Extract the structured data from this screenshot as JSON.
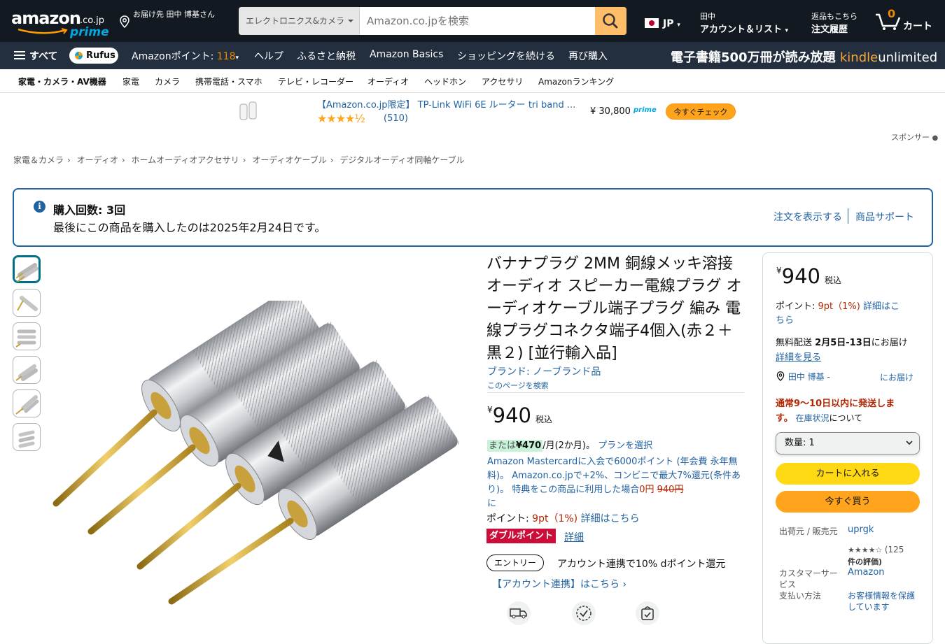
{
  "header": {
    "logo_word": "amazon",
    "logo_domain": ".co.jp",
    "logo_prime": "prime",
    "deliver_to": "お届け先 田中 博基さん",
    "search_category": "エレクトロニクス&カメラ",
    "search_placeholder": "Amazon.co.jpを検索",
    "lang": "JP",
    "account_line1": "田中",
    "account_line2": "アカウント＆リスト",
    "orders_line1": "返品もこちら",
    "orders_line2": "注文履歴",
    "cart_count": "0",
    "cart_label": "カート"
  },
  "subnav": {
    "all": "すべて",
    "rufus": "Rufus",
    "points_label": "Amazonポイント:",
    "points_value": "118",
    "items": [
      "ヘルプ",
      "ふるさと納税",
      "Amazon Basics",
      "ショッピングを続ける",
      "再び購入"
    ],
    "kindle_text": "電子書籍500万冊が読み放題",
    "kindle_brand": "kindle",
    "kindle_brand2": "unlimited"
  },
  "catbar": [
    "家電・カメラ・AV機器",
    "家電",
    "カメラ",
    "携帯電話・スマホ",
    "テレビ・レコーダー",
    "オーディオ",
    "ヘッドホン",
    "アクセサリ",
    "Amazonランキング"
  ],
  "ad": {
    "title": "【Amazon.co.jp限定】 TP-Link WiFi 6E ルーター tri band ...",
    "stars": "★★★★½",
    "rating_count": "(510)",
    "price": "¥ 30,800",
    "prime": "prime",
    "button": "今すぐチェック",
    "sponsored": "スポンサー"
  },
  "breadcrumb": [
    "家電＆カメラ",
    "オーディオ",
    "ホームオーディオアクセサリ",
    "オーディオケーブル",
    "デジタルオーディオ同軸ケーブル"
  ],
  "notice": {
    "heading": "購入回数: 3回",
    "detail": "最後にこの商品を購入したのは2025年2月24日です。",
    "link_order": "注文を表示する",
    "link_support": "商品サポート"
  },
  "product": {
    "title": "バナナプラグ 2MM 銅線メッキ溶接 オーディオ スピーカー電線プラグ オーディオケーブル端子プラグ 編み 電線プラグコネクタ端子4個入(赤２＋黒２) [並行輸入品]",
    "brand": "ブランド: ノーブランド品",
    "search_page": "このページを検索",
    "price_symbol": "¥",
    "price": "940",
    "tax": "税込",
    "install_prefix": "または",
    "install_amount": "¥470",
    "install_suffix": "/月(2か月)。",
    "install_link": "プランを選択",
    "mastercard_text": "Amazon Mastercardに入会で6000ポイント (年会費 永年無料)。 Amazon.co.jpで+2%、コンビニで最大7%還元(条件あり)。 特典をこの商品に利用した場合",
    "mastercard_price": "0円",
    "mastercard_original": "940円",
    "mastercard_tail": "に",
    "points_label": "ポイント:",
    "points_value": "9pt（1%)",
    "points_link": "詳細はこちら",
    "double_badge": "ダブルポイント",
    "double_link": "詳細",
    "entry_button": "エントリー",
    "entry_text": "アカウント連携で10% dポイント還元",
    "account_link": "【アカウント連携】はこちら ›"
  },
  "buybox": {
    "price_symbol": "¥",
    "price": "940",
    "tax": "税込",
    "points_label": "ポイント:",
    "points_value": "9pt（1%)",
    "points_link1": "詳細はこ",
    "points_link2": "ちら",
    "delivery_label": "無料配送",
    "delivery_date": "2月5日-13日",
    "delivery_suffix": "にお届け",
    "delivery_link": "詳細を見る",
    "addr_name": "田中 博基 -",
    "addr_suffix": "にお届け",
    "ship_line1": "通常9～10日以内に発送しま",
    "ship_line2": "す。",
    "stock_link": "在庫状況",
    "stock_suffix": "について",
    "qty": "数量: 1",
    "add_to_cart": "カートに入れる",
    "buy_now": "今すぐ買う",
    "ships_from_label": "出荷元 / 販売元",
    "ships_from_value": "uprgk",
    "seller_stars": "★★★★☆",
    "seller_count1": "(125",
    "seller_count2": "件の評価)",
    "cs_label1": "カスタマーサー",
    "cs_label2": "ビス",
    "cs_value": "Amazon",
    "pay_label": "支払い方法",
    "pay_value1": "お客様情報を保護",
    "pay_value2": "しています"
  }
}
